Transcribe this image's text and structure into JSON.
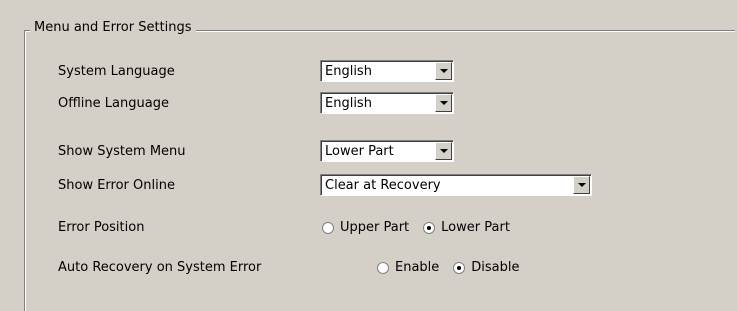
{
  "group_title": "Menu and Error Settings",
  "rows": {
    "system_language": {
      "label": "System Language",
      "value": "English"
    },
    "offline_language": {
      "label": "Offline Language",
      "value": "English"
    },
    "show_system_menu": {
      "label": "Show System Menu",
      "value": "Lower Part"
    },
    "show_error_online": {
      "label": "Show Error Online",
      "value": "Clear at Recovery"
    },
    "error_position": {
      "label": "Error Position",
      "options": [
        "Upper Part",
        "Lower Part"
      ],
      "selected": "Lower Part"
    },
    "auto_recovery": {
      "label": "Auto Recovery on System Error",
      "options": [
        "Enable",
        "Disable"
      ],
      "selected": "Disable"
    }
  }
}
